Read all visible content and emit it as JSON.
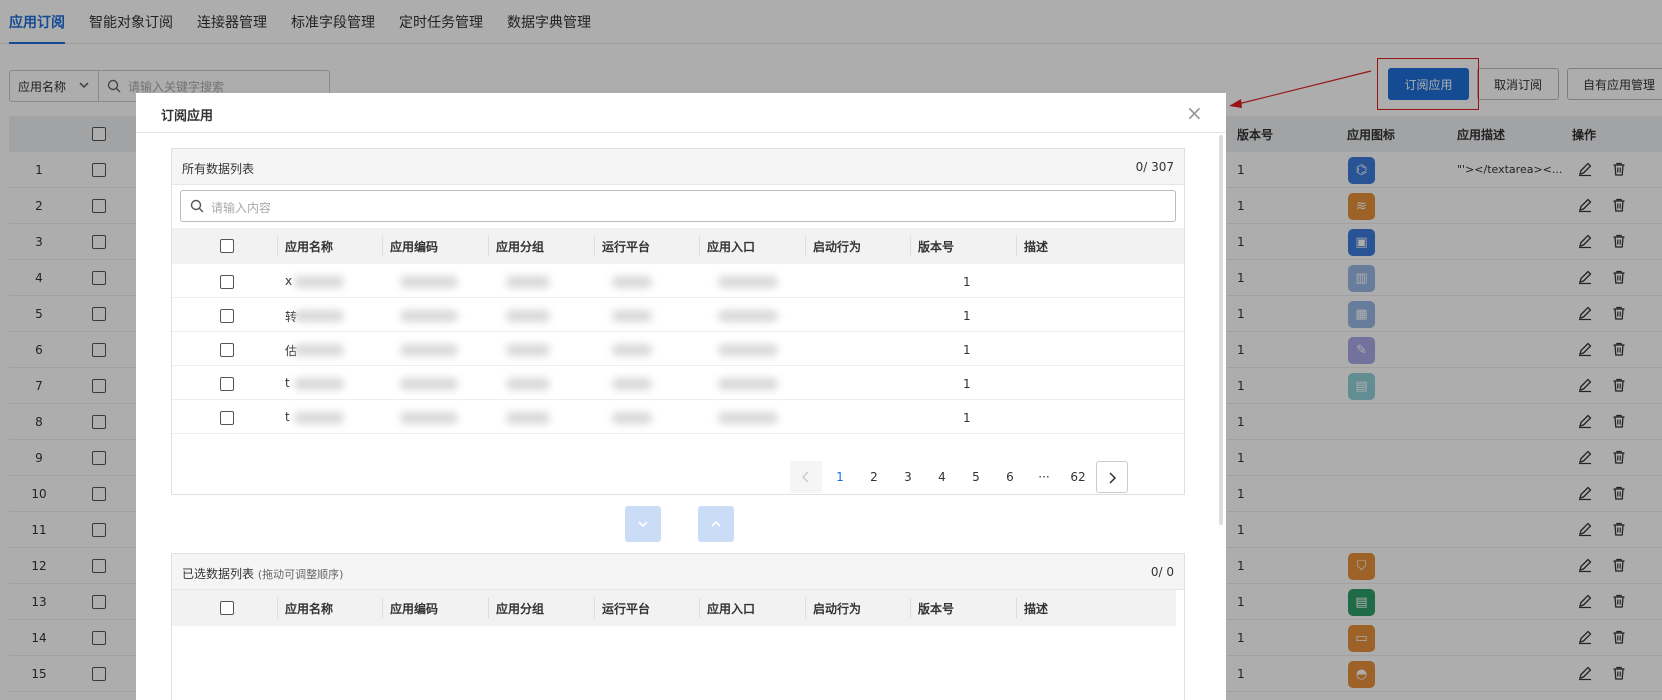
{
  "nav": {
    "tabs": [
      "应用订阅",
      "智能对象订阅",
      "连接器管理",
      "标准字段管理",
      "定时任务管理",
      "数据字典管理"
    ],
    "active_index": 0
  },
  "toolbar": {
    "filter_select": "应用名称",
    "search_placeholder": "请输入关键字搜索",
    "subscribe_btn": "订阅应用",
    "unsubscribe_btn": "取消订阅",
    "own_apps_btn": "自有应用管理"
  },
  "bg_table": {
    "columns": [
      "版本号",
      "应用图标",
      "应用描述",
      "操作"
    ],
    "rows": [
      {
        "idx": "1",
        "ver": "1",
        "desc": "\"'></textarea><...",
        "icon_color": "#3b7ddd",
        "icon": "cast-icon"
      },
      {
        "idx": "2",
        "ver": "1",
        "desc": "",
        "icon_color": "#e8913a",
        "icon": "database-icon"
      },
      {
        "idx": "3",
        "ver": "1",
        "desc": "",
        "icon_color": "#3b7ddd",
        "icon": "user-card-icon"
      },
      {
        "idx": "4",
        "ver": "1",
        "desc": "",
        "icon_color": "#9ab8e6",
        "icon": "chart-icon"
      },
      {
        "idx": "5",
        "ver": "1",
        "desc": "",
        "icon_color": "#9ab8e6",
        "icon": "map-icon"
      },
      {
        "idx": "6",
        "ver": "1",
        "desc": "",
        "icon_color": "#a9a8e6",
        "icon": "pencil-icon"
      },
      {
        "idx": "7",
        "ver": "1",
        "desc": "",
        "icon_color": "#8fd0d9",
        "icon": "save-icon"
      },
      {
        "idx": "8",
        "ver": "1",
        "desc": "",
        "icon_color": "",
        "icon": ""
      },
      {
        "idx": "9",
        "ver": "1",
        "desc": "",
        "icon_color": "",
        "icon": ""
      },
      {
        "idx": "10",
        "ver": "1",
        "desc": "",
        "icon_color": "",
        "icon": ""
      },
      {
        "idx": "11",
        "ver": "1",
        "desc": "",
        "icon_color": "",
        "icon": ""
      },
      {
        "idx": "12",
        "ver": "1",
        "desc": "",
        "icon_color": "#e8913a",
        "icon": "shield-icon"
      },
      {
        "idx": "13",
        "ver": "1",
        "desc": "",
        "icon_color": "#2f9e6a",
        "icon": "document-icon"
      },
      {
        "idx": "14",
        "ver": "1",
        "desc": "",
        "icon_color": "#e8913a",
        "icon": "inbox-icon"
      },
      {
        "idx": "15",
        "ver": "1",
        "desc": "",
        "icon_color": "#e8913a",
        "icon": "helmet-icon"
      }
    ]
  },
  "modal": {
    "title": "订阅应用",
    "close": "×",
    "all_list": {
      "title": "所有数据列表",
      "count": "0/ 307",
      "search_placeholder": "请输入内容",
      "columns": [
        "应用名称",
        "应用编码",
        "应用分组",
        "运行平台",
        "应用入口",
        "启动行为",
        "版本号",
        "描述"
      ],
      "rows": [
        {
          "name_initial": "x",
          "ver": "1"
        },
        {
          "name_initial": "转",
          "ver": "1"
        },
        {
          "name_initial": "估",
          "ver": "1"
        },
        {
          "name_initial": "t",
          "ver": "1"
        },
        {
          "name_initial": "t",
          "ver": "1"
        }
      ],
      "pager": {
        "pages": [
          "1",
          "2",
          "3",
          "4",
          "5",
          "6",
          "···",
          "62"
        ],
        "current": "1"
      }
    },
    "selected_list": {
      "title": "已选数据列表",
      "hint": "(拖动可调整顺序)",
      "count": "0/ 0",
      "columns": [
        "应用名称",
        "应用编码",
        "应用分组",
        "运行平台",
        "应用入口",
        "启动行为",
        "版本号",
        "描述"
      ]
    }
  }
}
